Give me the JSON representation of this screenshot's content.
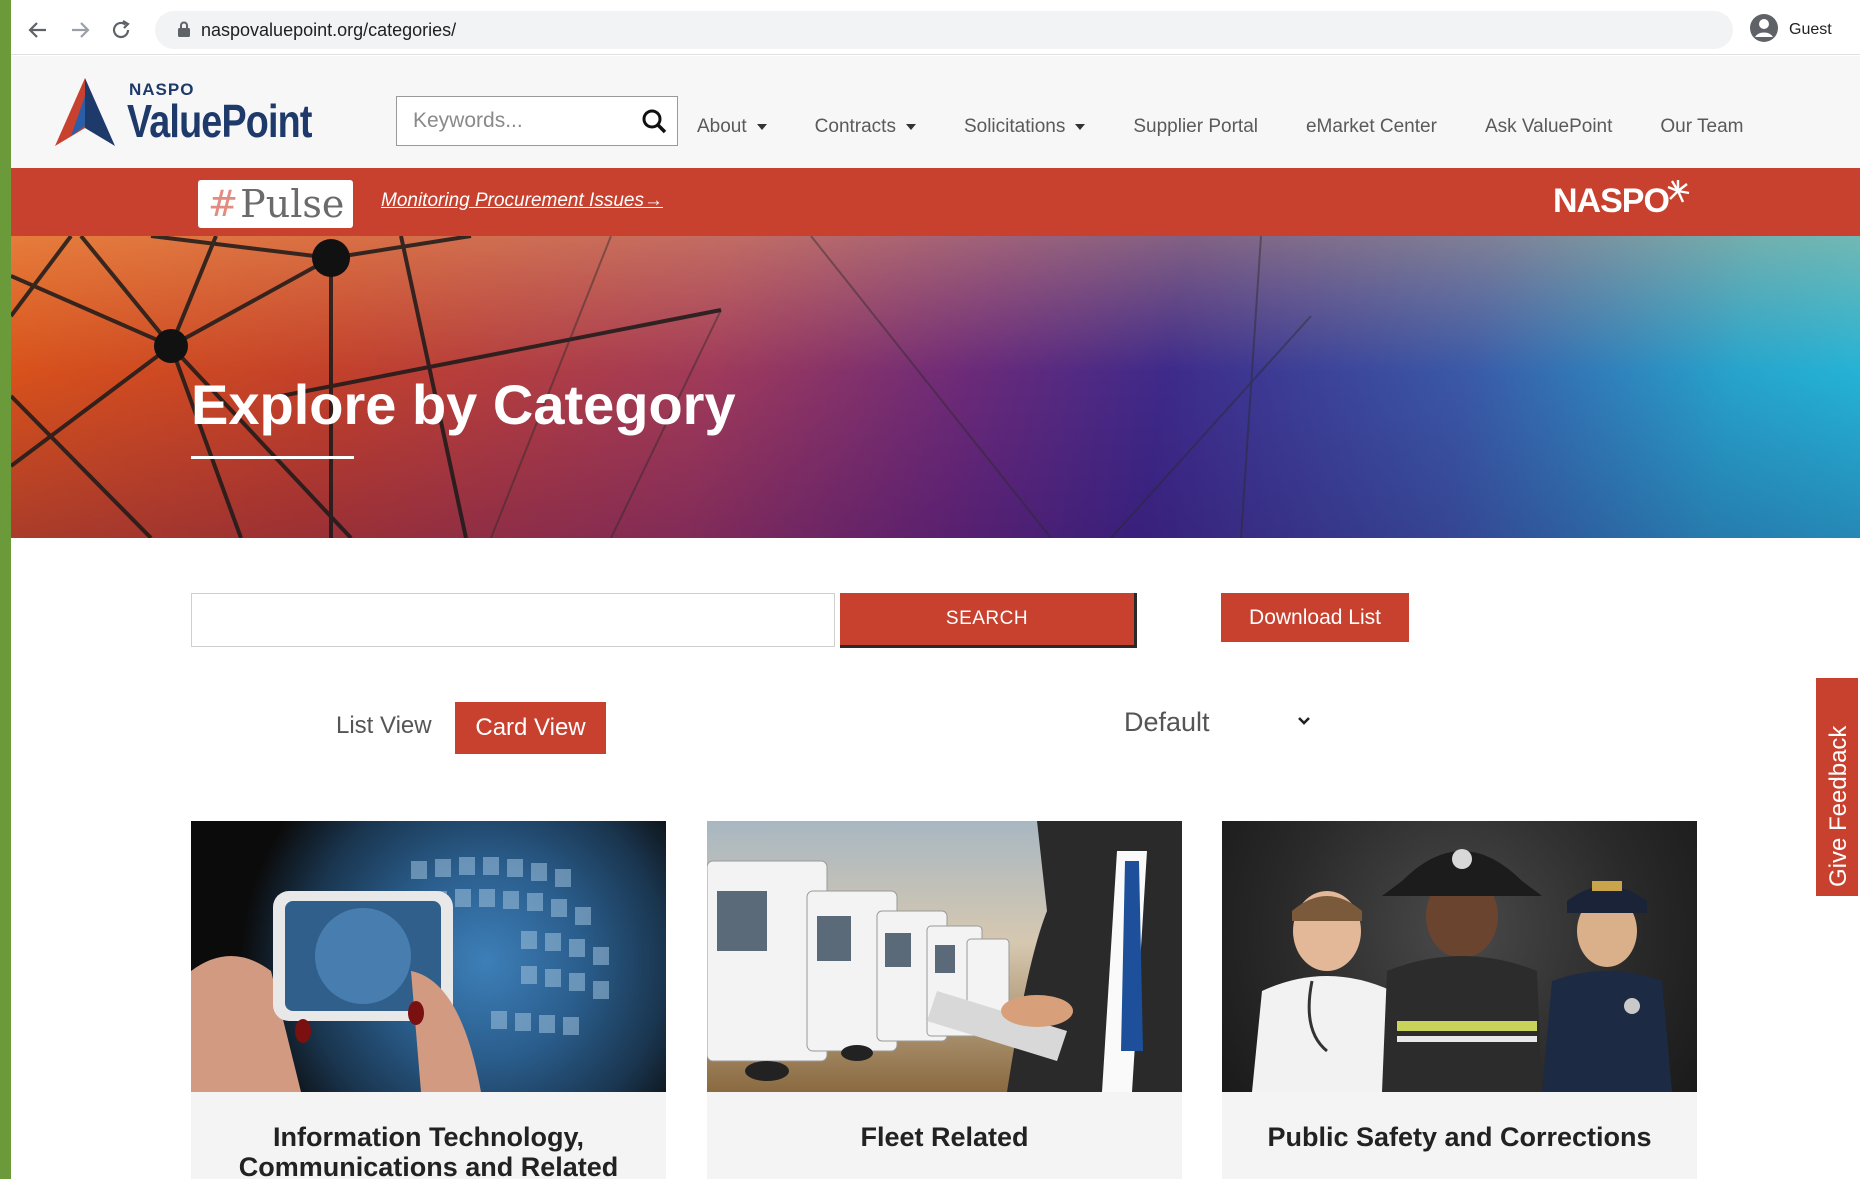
{
  "browser": {
    "url": "naspovaluepoint.org/categories/",
    "profile_label": "Guest"
  },
  "header": {
    "logo_top": "NASPO",
    "logo_main": "ValuePoint",
    "search_placeholder": "Keywords...",
    "nav": [
      {
        "label": "About",
        "dropdown": true
      },
      {
        "label": "Contracts",
        "dropdown": true
      },
      {
        "label": "Solicitations",
        "dropdown": true
      },
      {
        "label": "Supplier Portal",
        "dropdown": false
      },
      {
        "label": "eMarket Center",
        "dropdown": false
      },
      {
        "label": "Ask ValuePoint",
        "dropdown": false
      },
      {
        "label": "Our Team",
        "dropdown": false
      }
    ]
  },
  "pulse": {
    "badge_hash": "#",
    "badge_text": "Pulse",
    "link": "Monitoring Procurement Issues→",
    "brand": "NASPO"
  },
  "hero": {
    "title": "Explore by Category"
  },
  "controls": {
    "search_value": "",
    "search_button": "SEARCH",
    "download_button": "Download List",
    "list_view": "List View",
    "card_view": "Card View",
    "sort_value": "Default"
  },
  "feedback": {
    "label": "Give Feedback"
  },
  "cards": [
    {
      "title": "Information Technology, Communications and Related"
    },
    {
      "title": "Fleet Related"
    },
    {
      "title": "Public Safety and Corrections"
    }
  ],
  "colors": {
    "brand_red": "#c8412f",
    "navy": "#1e3a6b",
    "frame_green": "#6a9a3a"
  }
}
